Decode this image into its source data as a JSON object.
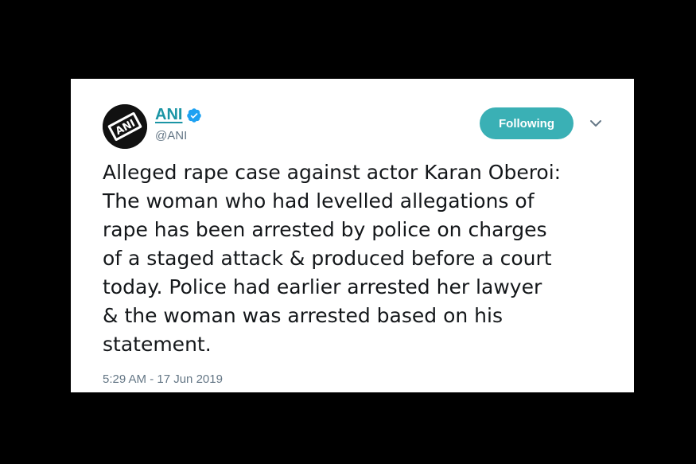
{
  "tweet": {
    "author": {
      "name": "ANI",
      "handle": "@ANI",
      "avatar_text": "ANI"
    },
    "follow_button": "Following",
    "text_lines": [
      "Alleged rape case against actor Karan Oberoi:",
      "The woman who had levelled allegations of",
      "rape has been arrested by police on charges",
      "of a staged attack & produced before a court",
      "today. Police had earlier arrested her lawyer",
      "& the woman was arrested based on his",
      "statement."
    ],
    "timestamp": "5:29 AM - 17 Jun 2019"
  },
  "colors": {
    "accent": "#1b95a5",
    "button": "#3ab0b5",
    "verified": "#1da1f2",
    "muted": "#657786"
  },
  "icons": [
    "ani-logo",
    "verified-badge-icon",
    "chevron-down-icon"
  ]
}
